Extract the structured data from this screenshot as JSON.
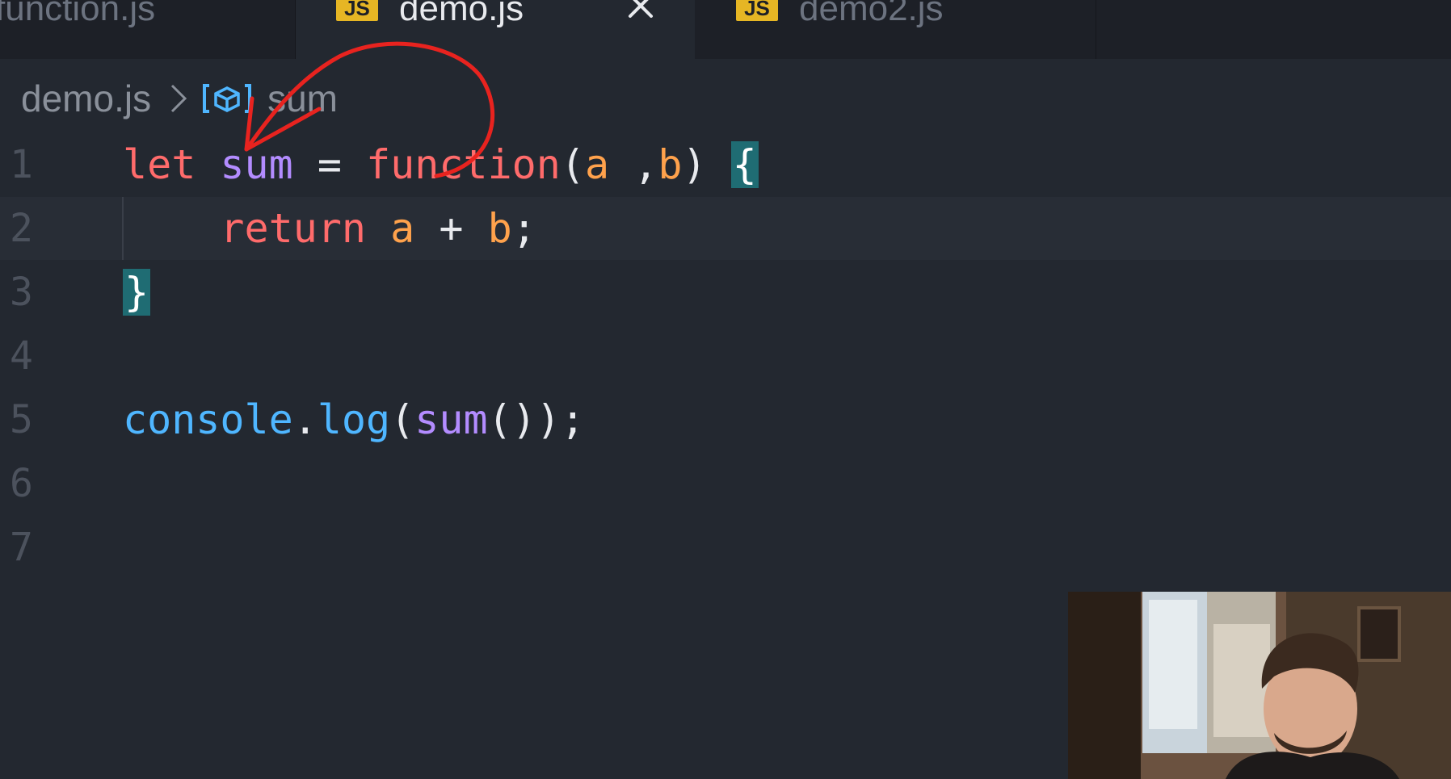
{
  "tabs": [
    {
      "label": "function.js",
      "icon": "",
      "active": false
    },
    {
      "label": "demo.js",
      "icon": "JS",
      "active": true
    },
    {
      "label": "demo2.js",
      "icon": "JS",
      "active": false
    }
  ],
  "breadcrumb": {
    "file": "demo.js",
    "symbol": "sum",
    "symbol_icon": "variable-icon"
  },
  "editor": {
    "line_numbers": [
      "1",
      "2",
      "3",
      "4",
      "5",
      "6",
      "7"
    ],
    "lines": {
      "l1": {
        "kw": "let",
        "var": "sum",
        "eq": "=",
        "fn": "function",
        "open": "(",
        "a": "a",
        "comma": " ,",
        "b": "b",
        "close": ")",
        "brace": "{"
      },
      "l2": {
        "kw": "return",
        "a": "a",
        "op": "+",
        "b": "b",
        "semi": ";"
      },
      "l3": {
        "brace": "}"
      },
      "l5": {
        "obj": "console",
        "dot": ".",
        "method": "log",
        "open": "(",
        "var": "sum",
        "call": "()",
        "close": ")",
        "semi": ";"
      }
    }
  },
  "colors": {
    "background": "#232830",
    "keyword": "#ff6b6b",
    "variable": "#b38cff",
    "parameter": "#ffa24c",
    "builtin": "#4fb6ff",
    "annotation": "#e8231f"
  },
  "webcam": {
    "description_icon": "webcam-overlay"
  }
}
